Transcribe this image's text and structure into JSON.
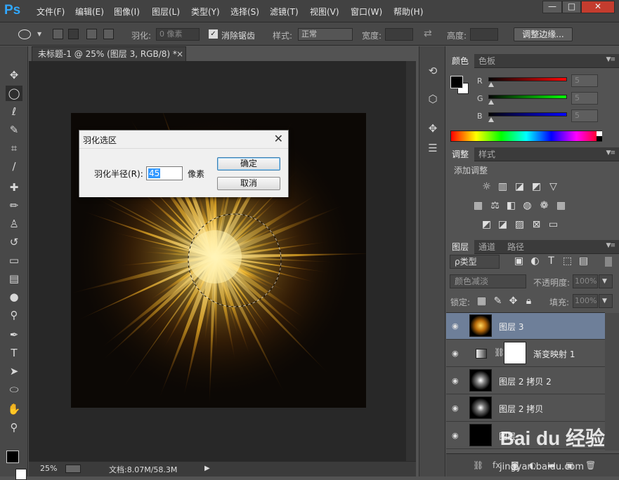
{
  "app": {
    "logo": "Ps"
  },
  "menu": [
    "文件(F)",
    "编辑(E)",
    "图像(I)",
    "图层(L)",
    "类型(Y)",
    "选择(S)",
    "滤镜(T)",
    "视图(V)",
    "窗口(W)",
    "帮助(H)"
  ],
  "window_controls": {
    "minimize": "—",
    "restore": "□",
    "close": "✕"
  },
  "options": {
    "feather_label": "羽化:",
    "feather_value": "0 像素",
    "antialias_label": "消除锯齿",
    "style_label": "样式:",
    "style_value": "正常",
    "width_label": "宽度:",
    "height_label": "高度:",
    "refine_edge": "调整边缘..."
  },
  "document": {
    "tab_title": "未标题-1 @ 25% (图层 3, RGB/8) *",
    "zoom": "25%",
    "doc_info": "文档:8.07M/58.3M"
  },
  "dialog": {
    "title": "羽化选区",
    "radius_label": "羽化半径(R):",
    "radius_value": "45",
    "unit": "像素",
    "ok": "确定",
    "cancel": "取消"
  },
  "color_panel": {
    "tabs": [
      "颜色",
      "色板"
    ],
    "channels": [
      {
        "label": "R",
        "value": "5"
      },
      {
        "label": "G",
        "value": "5"
      },
      {
        "label": "B",
        "value": "5"
      }
    ]
  },
  "adjustments_panel": {
    "tabs": [
      "调整",
      "样式"
    ],
    "heading": "添加调整"
  },
  "layers_panel": {
    "tabs": [
      "图层",
      "通道",
      "路径"
    ],
    "filter_kind": "ρ类型",
    "blend_mode": "颜色减淡",
    "opacity_label": "不透明度:",
    "opacity_value": "100%",
    "lock_label": "锁定:",
    "fill_label": "填充:",
    "fill_value": "100%",
    "layers": [
      {
        "name": "图层 3",
        "selected": true
      },
      {
        "name": "渐变映射 1",
        "selected": false
      },
      {
        "name": "图层 2 拷贝 2",
        "selected": false
      },
      {
        "name": "图层 2 拷贝",
        "selected": false
      },
      {
        "name": "图层",
        "selected": false
      }
    ]
  },
  "watermark": {
    "brand": "Bai du 经验",
    "url": "jingyan.baidu.com"
  },
  "colors": {
    "accent_blue": "#31a8ff",
    "selected_layer": "#6e7f99",
    "canvas_bg": "#0c0805"
  }
}
